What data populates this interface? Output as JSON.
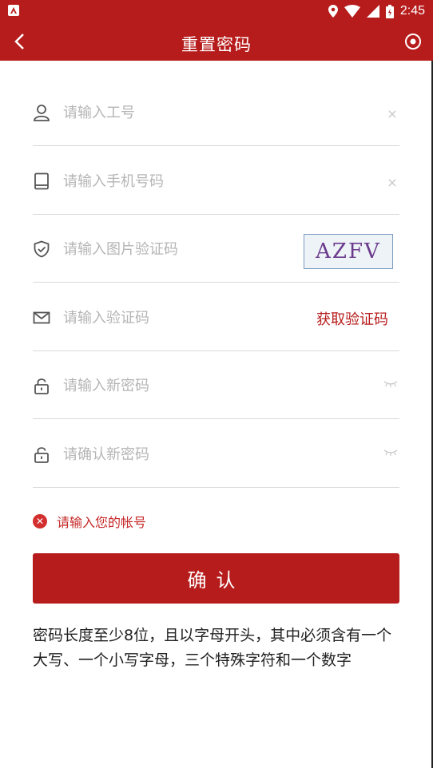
{
  "status_bar": {
    "time": "2:45",
    "icons": [
      "location-icon",
      "wifi-icon",
      "signal-icon",
      "battery-icon"
    ]
  },
  "app_bar": {
    "title": "重置密码",
    "back_icon": "chevron-left-icon",
    "action_icon": "target-icon"
  },
  "form": {
    "employee_id": {
      "placeholder": "请输入工号",
      "icon": "user-icon",
      "clear": "×"
    },
    "phone": {
      "placeholder": "请输入手机号码",
      "icon": "tablet-icon",
      "clear": "×"
    },
    "image_captcha": {
      "placeholder": "请输入图片验证码",
      "icon": "shield-check-icon",
      "captcha_text": "AZFV"
    },
    "sms_code": {
      "placeholder": "请输入验证码",
      "icon": "mail-icon",
      "get_code_label": "获取验证码"
    },
    "new_password": {
      "placeholder": "请输入新密码",
      "icon": "lock-icon"
    },
    "confirm_password": {
      "placeholder": "请确认新密码",
      "icon": "lock-icon"
    }
  },
  "error_message": "请输入您的帐号",
  "confirm_button": "确认",
  "hint_text": "密码长度至少8位，且以字母开头，其中必须含有一个大写、一个小写字母，三个特殊字符和一个数字",
  "colors": {
    "primary": "#b71c1c",
    "error": "#d32f2f",
    "placeholder": "#b5b5b5",
    "divider": "#d9d9d9"
  }
}
